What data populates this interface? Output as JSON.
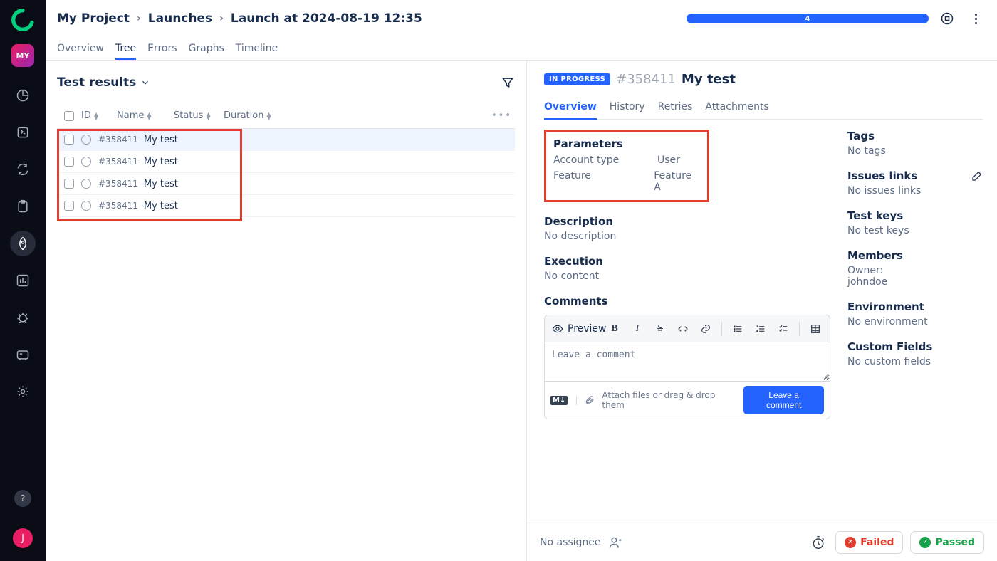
{
  "leftnav": {
    "projectBadge": "MY",
    "userInitial": "J"
  },
  "breadcrumbs": {
    "project": "My Project",
    "section": "Launches",
    "launch": "Launch at 2024-08-19 12:35"
  },
  "progress": {
    "label": "4"
  },
  "subtabs": [
    "Overview",
    "Tree",
    "Errors",
    "Graphs",
    "Timeline"
  ],
  "subtabActive": "Tree",
  "leftPane": {
    "title": "Test results",
    "columns": {
      "id": "ID",
      "name": "Name",
      "status": "Status",
      "duration": "Duration"
    },
    "rows": [
      {
        "id": "#358411",
        "name": "My test",
        "selected": true
      },
      {
        "id": "#358411",
        "name": "My test",
        "selected": false
      },
      {
        "id": "#358411",
        "name": "My test",
        "selected": false
      },
      {
        "id": "#358411",
        "name": "My test",
        "selected": false
      }
    ]
  },
  "detail": {
    "badge": "IN PROGRESS",
    "id": "#358411",
    "name": "My test",
    "tabs": [
      "Overview",
      "History",
      "Retries",
      "Attachments"
    ],
    "tabActive": "Overview",
    "parameters": {
      "title": "Parameters",
      "rows": [
        {
          "key": "Account type",
          "value": "User"
        },
        {
          "key": "Feature",
          "value": "Feature A"
        }
      ]
    },
    "description": {
      "title": "Description",
      "body": "No description"
    },
    "execution": {
      "title": "Execution",
      "body": "No content"
    },
    "comments": {
      "title": "Comments",
      "preview": "Preview",
      "placeholder": "Leave a comment",
      "attachHint": "Attach files or drag & drop them",
      "submit": "Leave a comment"
    },
    "side": {
      "tags": {
        "title": "Tags",
        "body": "No tags"
      },
      "issues": {
        "title": "Issues links",
        "body": "No issues links"
      },
      "keys": {
        "title": "Test keys",
        "body": "No test keys"
      },
      "members": {
        "title": "Members",
        "ownerLabel": "Owner:",
        "owner": "johndoe"
      },
      "env": {
        "title": "Environment",
        "body": "No environment"
      },
      "custom": {
        "title": "Custom Fields",
        "body": "No custom fields"
      }
    }
  },
  "bottom": {
    "assignee": "No assignee",
    "failed": "Failed",
    "passed": "Passed"
  }
}
